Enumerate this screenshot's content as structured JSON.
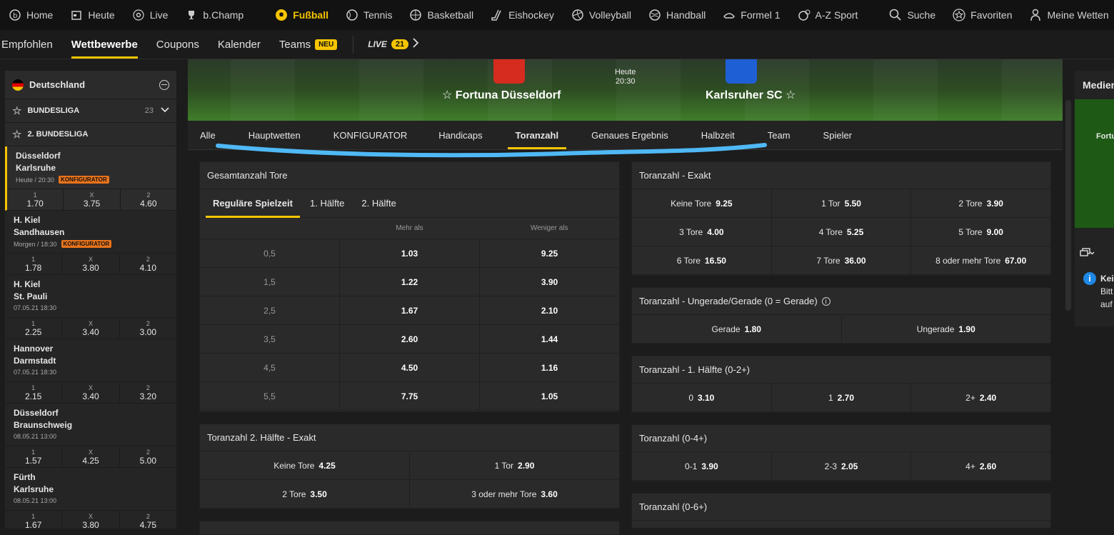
{
  "topnav": {
    "items": [
      {
        "label": "Home",
        "icon": "home-icon"
      },
      {
        "label": "Heute",
        "icon": "calendar-icon"
      },
      {
        "label": "Live",
        "icon": "live-icon"
      },
      {
        "label": "b.Champ",
        "icon": "trophy-icon"
      }
    ],
    "sports": [
      {
        "label": "Fußball",
        "icon": "football-icon",
        "active": true
      },
      {
        "label": "Tennis",
        "icon": "tennis-icon"
      },
      {
        "label": "Basketball",
        "icon": "basketball-icon"
      },
      {
        "label": "Eishockey",
        "icon": "hockey-icon"
      },
      {
        "label": "Volleyball",
        "icon": "volleyball-icon"
      },
      {
        "label": "Handball",
        "icon": "handball-icon"
      },
      {
        "label": "Formel 1",
        "icon": "formula1-icon"
      },
      {
        "label": "A-Z Sport",
        "icon": "az-sport-icon"
      }
    ],
    "right": [
      {
        "label": "Suche",
        "icon": "search-icon"
      },
      {
        "label": "Favoriten",
        "icon": "star-icon"
      },
      {
        "label": "Meine Wetten",
        "icon": "user-icon"
      }
    ]
  },
  "subnav": {
    "items": [
      "Empfohlen",
      "Wettbewerbe",
      "Coupons",
      "Kalender",
      "Teams"
    ],
    "teams_badge": "NEU",
    "live_label": "LIVE",
    "live_count": "21"
  },
  "sidebar": {
    "country": "Deutschland",
    "leagues": [
      {
        "name": "BUNDESLIGA",
        "count": "23"
      },
      {
        "name": "2. BUNDESLIGA",
        "count": ""
      }
    ],
    "matches": [
      {
        "home": "Düsseldorf",
        "away": "Karlsruhe",
        "time": "Heute / 20:30",
        "badge": "KONFIGURATOR",
        "o1": "1.70",
        "ox": "3.75",
        "o2": "4.60"
      },
      {
        "home": "H. Kiel",
        "away": "Sandhausen",
        "time": "Morgen / 18:30",
        "badge": "KONFIGURATOR",
        "o1": "1.78",
        "ox": "3.80",
        "o2": "4.10"
      },
      {
        "home": "H. Kiel",
        "away": "St. Pauli",
        "time": "07.05.21 18:30",
        "badge": "",
        "o1": "2.25",
        "ox": "3.40",
        "o2": "3.00"
      },
      {
        "home": "Hannover",
        "away": "Darmstadt",
        "time": "07.05.21 18:30",
        "badge": "",
        "o1": "2.15",
        "ox": "3.40",
        "o2": "3.20"
      },
      {
        "home": "Düsseldorf",
        "away": "Braunschweig",
        "time": "08.05.21 13:00",
        "badge": "",
        "o1": "1.57",
        "ox": "4.25",
        "o2": "5.00"
      },
      {
        "home": "Fürth",
        "away": "Karlsruhe",
        "time": "08.05.21 13:00",
        "badge": "",
        "o1": "1.67",
        "ox": "3.80",
        "o2": "4.75"
      }
    ],
    "labels": {
      "one": "1",
      "x": "X",
      "two": "2"
    }
  },
  "hero": {
    "home": "Fortuna Düsseldorf",
    "away": "Karlsruher SC",
    "day": "Heute",
    "time": "20:30",
    "home_color": "#d62b1f",
    "away_color": "#1f5fd6"
  },
  "tabs": [
    "Alle",
    "Hauptwetten",
    "KONFIGURATOR",
    "Handicaps",
    "Toranzahl",
    "Genaues Ergebnis",
    "Halbzeit",
    "Team",
    "Spieler"
  ],
  "gesamt": {
    "title": "Gesamtanzahl Tore",
    "subtabs": [
      "Reguläre Spielzeit",
      "1. Hälfte",
      "2. Hälfte"
    ],
    "col_more": "Mehr als",
    "col_less": "Weniger als",
    "rows": [
      {
        "line": "0,5",
        "more": "1.03",
        "less": "9.25"
      },
      {
        "line": "1,5",
        "more": "1.22",
        "less": "3.90"
      },
      {
        "line": "2,5",
        "more": "1.67",
        "less": "2.10"
      },
      {
        "line": "3,5",
        "more": "2.60",
        "less": "1.44"
      },
      {
        "line": "4,5",
        "more": "4.50",
        "less": "1.16"
      },
      {
        "line": "5,5",
        "more": "7.75",
        "less": "1.05"
      }
    ]
  },
  "h2exakt": {
    "title": "Toranzahl 2. Hälfte - Exakt",
    "cells": [
      {
        "label": "Keine Tore",
        "odd": "4.25"
      },
      {
        "label": "1 Tor",
        "odd": "2.90"
      },
      {
        "label": "2 Tore",
        "odd": "3.50"
      },
      {
        "label": "3 oder mehr Tore",
        "odd": "3.60"
      }
    ]
  },
  "exakt": {
    "title": "Toranzahl - Exakt",
    "cells": [
      {
        "label": "Keine Tore",
        "odd": "9.25"
      },
      {
        "label": "1 Tor",
        "odd": "5.50"
      },
      {
        "label": "2 Tore",
        "odd": "3.90"
      },
      {
        "label": "3 Tore",
        "odd": "4.00"
      },
      {
        "label": "4 Tore",
        "odd": "5.25"
      },
      {
        "label": "5 Tore",
        "odd": "9.00"
      },
      {
        "label": "6 Tore",
        "odd": "16.50"
      },
      {
        "label": "7 Tore",
        "odd": "36.00"
      },
      {
        "label": "8 oder mehr Tore",
        "odd": "67.00"
      }
    ]
  },
  "ungerade": {
    "title": "Toranzahl - Ungerade/Gerade (0 = Gerade)",
    "cells": [
      {
        "label": "Gerade",
        "odd": "1.80"
      },
      {
        "label": "Ungerade",
        "odd": "1.90"
      }
    ]
  },
  "h1": {
    "title": "Toranzahl - 1. Hälfte (0-2+)",
    "cells": [
      {
        "label": "0",
        "odd": "3.10"
      },
      {
        "label": "1",
        "odd": "2.70"
      },
      {
        "label": "2+",
        "odd": "2.40"
      }
    ]
  },
  "t04": {
    "title": "Toranzahl (0-4+)",
    "cells": [
      {
        "label": "0-1",
        "odd": "3.90"
      },
      {
        "label": "2-3",
        "odd": "2.05"
      },
      {
        "label": "4+",
        "odd": "2.60"
      }
    ]
  },
  "t06": {
    "title": "Toranzahl (0-6+)"
  },
  "rightpanel": {
    "title": "Medien",
    "team_snippet": "Fortu",
    "info_lines": [
      "Kei",
      "Bitt",
      "auf"
    ]
  }
}
